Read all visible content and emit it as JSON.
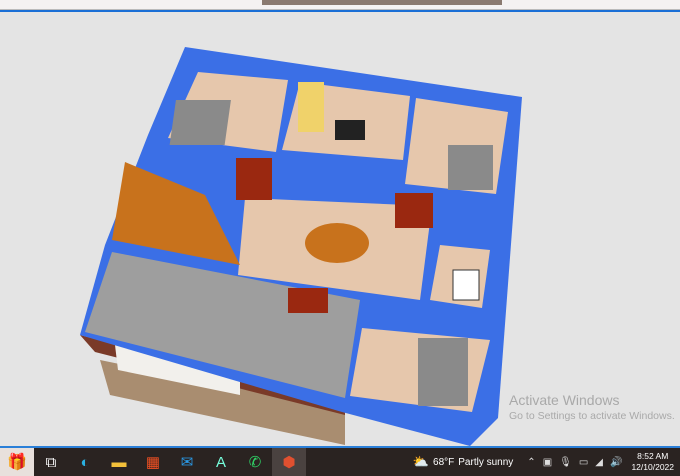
{
  "taskbar": {
    "apps": [
      {
        "name": "task-view",
        "glyph": "⧉"
      },
      {
        "name": "edge",
        "glyph": "◐"
      },
      {
        "name": "file-explorer",
        "glyph": "▬"
      },
      {
        "name": "microsoft-store",
        "glyph": "▦"
      },
      {
        "name": "mail",
        "glyph": "✉"
      },
      {
        "name": "app-ai",
        "glyph": "A"
      },
      {
        "name": "whatsapp",
        "glyph": "✆"
      },
      {
        "name": "home-design-app",
        "glyph": "⬢"
      }
    ],
    "weather": {
      "temp": "68°F",
      "condition": "Partly sunny"
    },
    "clock": {
      "time": "8:52 AM",
      "date": "12/10/2022"
    }
  },
  "watermark": {
    "title": "Activate Windows",
    "subtitle": "Go to Settings to activate Windows."
  },
  "colors": {
    "wall": "#3b6fe6",
    "floor": "#e6c7ac",
    "garage": "#9e9e9e",
    "stairs": "#c8721c",
    "ground": "#a98d70",
    "facade": "#7a3a28"
  }
}
